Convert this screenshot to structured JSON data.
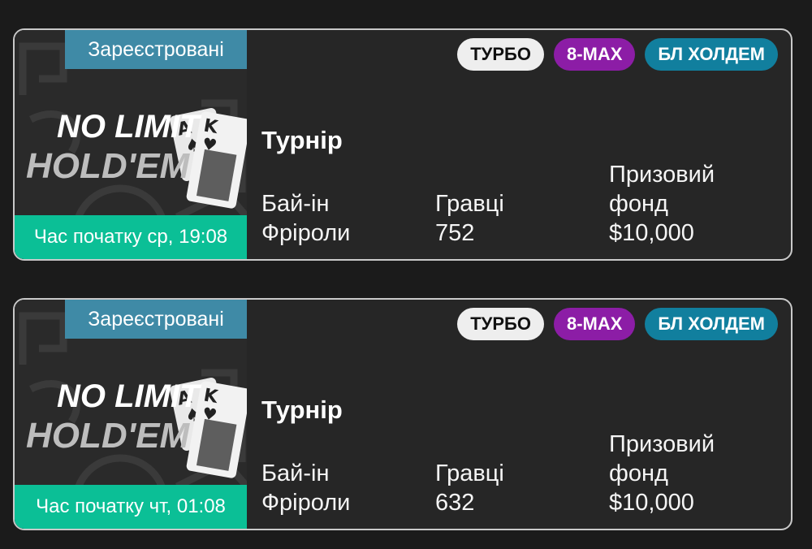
{
  "tournaments": [
    {
      "status": "Зареєстровані",
      "art_line1": "NO LIMIT",
      "art_line2": "HOLD'EM",
      "start_time": "Час початку ср, 19:08",
      "tags": {
        "turbo": "ТУРБО",
        "max": "8-MAX",
        "game": "БЛ ХОЛДЕМ"
      },
      "title": "Турнір",
      "buyin_label": "Бай-ін",
      "buyin_value": "Фріроли",
      "players_label": "Гравці",
      "players_value": "752",
      "prize_label": "Призовий фонд",
      "prize_value": "$10,000"
    },
    {
      "status": "Зареєстровані",
      "art_line1": "NO LIMIT",
      "art_line2": "HOLD'EM",
      "start_time": "Час початку чт, 01:08",
      "tags": {
        "turbo": "ТУРБО",
        "max": "8-MAX",
        "game": "БЛ ХОЛДЕМ"
      },
      "title": "Турнір",
      "buyin_label": "Бай-ін",
      "buyin_value": "Фріроли",
      "players_label": "Гравці",
      "players_value": "632",
      "prize_label": "Призовий фонд",
      "prize_value": "$10,000"
    }
  ],
  "colors": {
    "background": "#1b1b1b",
    "card": "#262626",
    "status_badge": "#3f8aa6",
    "start_bar": "#0bbf96",
    "turbo_tag": "#eeeeee",
    "max_tag": "#8c1da6",
    "game_tag": "#117f9e"
  },
  "icons": [
    "ace-of-spades-card-icon",
    "king-of-hearts-card-icon"
  ]
}
